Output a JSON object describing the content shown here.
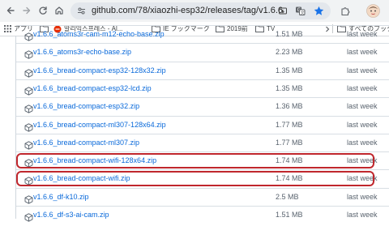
{
  "browser": {
    "url": "github.com/78/xiaozhi-esp32/releases/tag/v1.6.6"
  },
  "bookmarks": {
    "apps": "アプリ",
    "items": [
      "알리익스프레스 - Al...",
      "IE ブックマーク",
      "2019前",
      "TV"
    ],
    "all_bookmarks": "すべてのブックマ"
  },
  "assets": [
    {
      "name": "v1.6.6_atoms3r-cam-m12-echo-base.zip",
      "size": "1.51 MB",
      "date": "last week",
      "highlighted": false
    },
    {
      "name": "v1.6.6_atoms3r-echo-base.zip",
      "size": "2.23 MB",
      "date": "last week",
      "highlighted": false
    },
    {
      "name": "v1.6.6_bread-compact-esp32-128x32.zip",
      "size": "1.35 MB",
      "date": "last week",
      "highlighted": false
    },
    {
      "name": "v1.6.6_bread-compact-esp32-lcd.zip",
      "size": "1.35 MB",
      "date": "last week",
      "highlighted": false
    },
    {
      "name": "v1.6.6_bread-compact-esp32.zip",
      "size": "1.36 MB",
      "date": "last week",
      "highlighted": false
    },
    {
      "name": "v1.6.6_bread-compact-ml307-128x64.zip",
      "size": "1.77 MB",
      "date": "last week",
      "highlighted": false
    },
    {
      "name": "v1.6.6_bread-compact-ml307.zip",
      "size": "1.77 MB",
      "date": "last week",
      "highlighted": false
    },
    {
      "name": "v1.6.6_bread-compact-wifi-128x64.zip",
      "size": "1.74 MB",
      "date": "last week",
      "highlighted": true
    },
    {
      "name": "v1.6.6_bread-compact-wifi.zip",
      "size": "1.74 MB",
      "date": "last week",
      "highlighted": true
    },
    {
      "name": "v1.6.6_df-k10.zip",
      "size": "2.5 MB",
      "date": "last week",
      "highlighted": false
    },
    {
      "name": "v1.6.6_df-s3-ai-cam.zip",
      "size": "1.51 MB",
      "date": "last week",
      "highlighted": false
    }
  ],
  "colors": {
    "link": "#0969da",
    "muted": "#59636e",
    "highlight": "#c0272d",
    "toolbar_bg": "#f1f3f4",
    "star": "#1a73e8"
  },
  "icons": {
    "toolbar": [
      "back-arrow-icon",
      "forward-arrow-icon",
      "reload-icon",
      "home-icon",
      "site-info-icon",
      "install-app-icon",
      "translate-icon",
      "bookmark-star-icon",
      "extensions-icon",
      "profile-avatar"
    ],
    "asset": "package-icon"
  }
}
